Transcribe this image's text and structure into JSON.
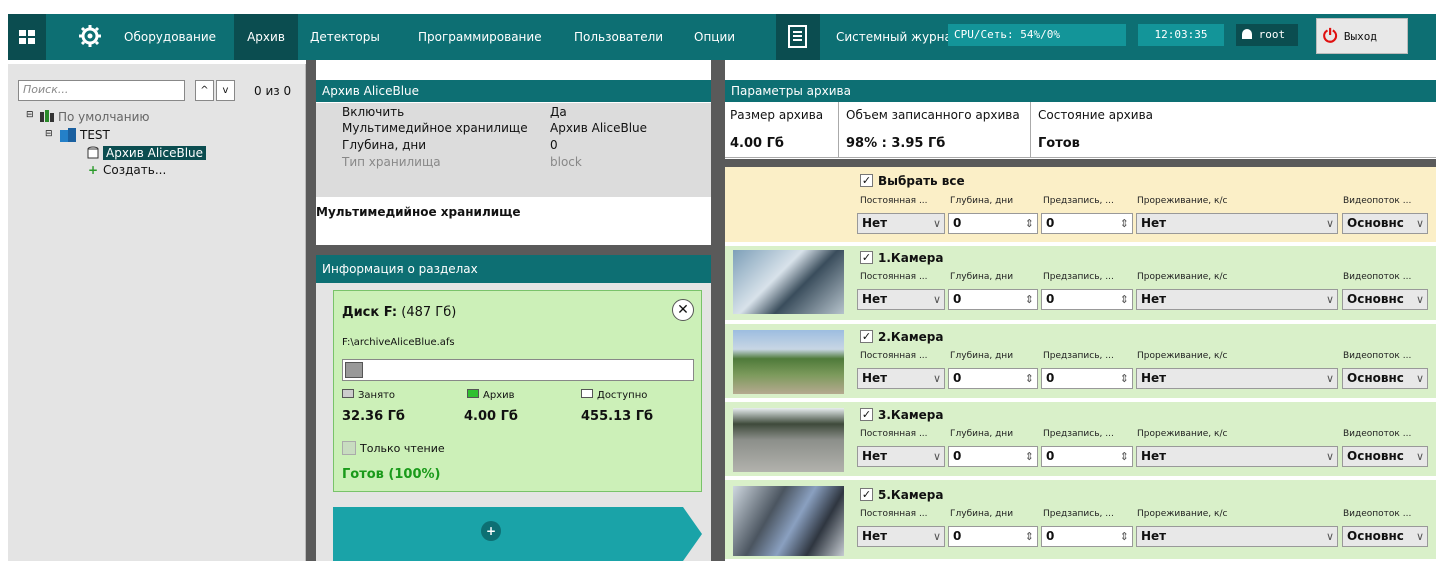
{
  "topbar": {
    "equipment": "Оборудование",
    "archive": "Архив",
    "detectors": "Детекторы",
    "programming": "Программирование",
    "users": "Пользователи",
    "options": "Опции",
    "syslog": "Системный журнал",
    "cpu": "CPU/Сеть: 54%/0%",
    "clock": "12:03:35",
    "user": "root",
    "logout": "Выход"
  },
  "tree": {
    "search_placeholder": "Поиск...",
    "counter": "0 из 0",
    "default": "По умолчанию",
    "server": "TEST",
    "archive_item": "Архив AliceBlue",
    "create": "Создать..."
  },
  "archive_props": {
    "header": "Архив AliceBlue",
    "rows": [
      {
        "k": "Включить",
        "v": "Да"
      },
      {
        "k": "Мультимедийное хранилище",
        "v": "Архив AliceBlue"
      },
      {
        "k": "Глубина, дни",
        "v": "0"
      },
      {
        "k": "Тип хранилища",
        "v": "block"
      }
    ],
    "section_title": "Мультимедийное хранилище"
  },
  "partitions": {
    "header": "Информация о разделах",
    "disk_label": "Диск F:",
    "disk_size": "(487 Гб)",
    "path": "F:\\archiveAliceBlue.afs",
    "legend_used": "Занято",
    "legend_archive": "Архив",
    "legend_free": "Доступно",
    "used": "32.36 Гб",
    "archive": "4.00 Гб",
    "free": "455.13 Гб",
    "readonly": "Только чтение",
    "status": "Готов (100%)",
    "add_icon": "+"
  },
  "params": {
    "header": "Параметры архива",
    "col1": "Размер архива",
    "col2": "Объем записанного архива",
    "col3": "Состояние архива",
    "val1": "4.00 Гб",
    "val2": "98% : 3.95 Гб",
    "val3": "Готов"
  },
  "columns": {
    "permanent": "Постоянная ...",
    "depth": "Глубина, дни",
    "prerec": "Предзапись, ...",
    "thinning": "Прореживание, к/с",
    "stream": "Видеопоток ..."
  },
  "select_all": {
    "title": "Выбрать все",
    "permanent": "Нет",
    "depth": "0",
    "prerec": "0",
    "thinning": "Нет",
    "stream": "Основнс"
  },
  "cameras": [
    {
      "title": "1.Камера",
      "permanent": "Нет",
      "depth": "0",
      "prerec": "0",
      "thinning": "Нет",
      "stream": "Основнс"
    },
    {
      "title": "2.Камера",
      "permanent": "Нет",
      "depth": "0",
      "prerec": "0",
      "thinning": "Нет",
      "stream": "Основнс"
    },
    {
      "title": "3.Камера",
      "permanent": "Нет",
      "depth": "0",
      "prerec": "0",
      "thinning": "Нет",
      "stream": "Основнс"
    },
    {
      "title": "5.Камера",
      "permanent": "Нет",
      "depth": "0",
      "prerec": "0",
      "thinning": "Нет",
      "stream": "Основнс"
    }
  ],
  "colors": {
    "accent": "#0d6f73",
    "accent_dark": "#0b4d50",
    "row_green": "#d9f0c9",
    "row_yellow": "#fbefc7",
    "status_green": "#1a9a1a"
  }
}
